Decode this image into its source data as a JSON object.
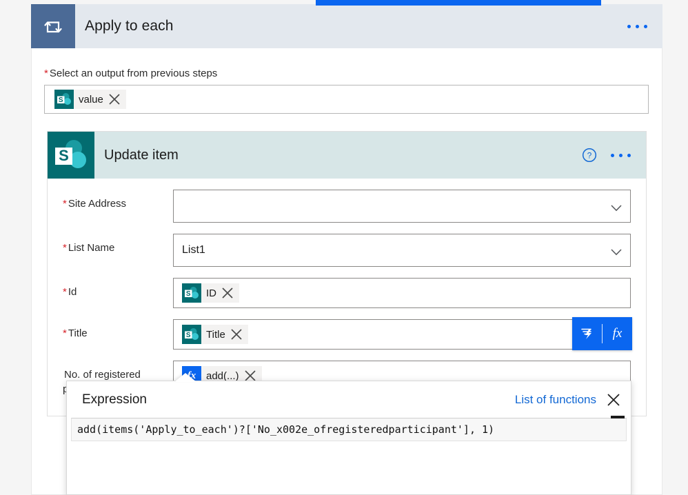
{
  "colors": {
    "accent_blue": "#0a66f0",
    "link_blue": "#1268d4",
    "loop_tile": "#4b6a96",
    "loop_header_bg": "#e3e8ee",
    "sharepoint_teal": "#0f7b7b",
    "sharepoint_dark": "#036c70",
    "card_header_bg": "#d7e6e7",
    "required_star": "#d6232a",
    "token_bg": "#f3f2f1"
  },
  "loop_card": {
    "icon": "loop-repeat-icon",
    "title": "Apply to each",
    "overflow_menu": "ellipsis-icon",
    "select_output": {
      "required_marker": "*",
      "label": "Select an output from previous steps",
      "token": {
        "icon": "sharepoint-icon",
        "label": "value",
        "remove_icon": "close-x-icon"
      }
    }
  },
  "update_card": {
    "icon": "sharepoint-icon",
    "title": "Update item",
    "help_icon": "help-circle-icon",
    "overflow_menu": "ellipsis-icon",
    "fields": [
      {
        "required_marker": "*",
        "label": "Site Address",
        "type": "dropdown",
        "value": "",
        "chevron": "chevron-down-icon"
      },
      {
        "required_marker": "*",
        "label": "List Name",
        "type": "dropdown",
        "value": "List1",
        "chevron": "chevron-down-icon"
      },
      {
        "required_marker": "*",
        "label": "Id",
        "type": "token",
        "token": {
          "icon": "sharepoint-icon",
          "label": "ID",
          "remove_icon": "close-x-icon"
        }
      },
      {
        "required_marker": "*",
        "label": "Title",
        "type": "token",
        "token": {
          "icon": "sharepoint-icon",
          "label": "Title",
          "remove_icon": "close-x-icon"
        }
      },
      {
        "required_marker": "",
        "label": "No. of registered participants",
        "type": "token",
        "token": {
          "icon": "fx-icon",
          "label": "add(...)",
          "remove_icon": "close-x-icon"
        }
      }
    ],
    "dynamic_buttons": {
      "dynamic_content_icon": "lightning-bolt-icon",
      "expression_icon": "fx-icon",
      "expression_glyph": "fx"
    }
  },
  "expression_flyout": {
    "title": "Expression",
    "list_of_functions_label": "List of functions",
    "close_icon": "close-x-icon",
    "input_value": "add(items('Apply_to_each')?['No_x002e_ofregisteredparticipant'], 1)",
    "resize_grip": "resize-grip-icon"
  }
}
